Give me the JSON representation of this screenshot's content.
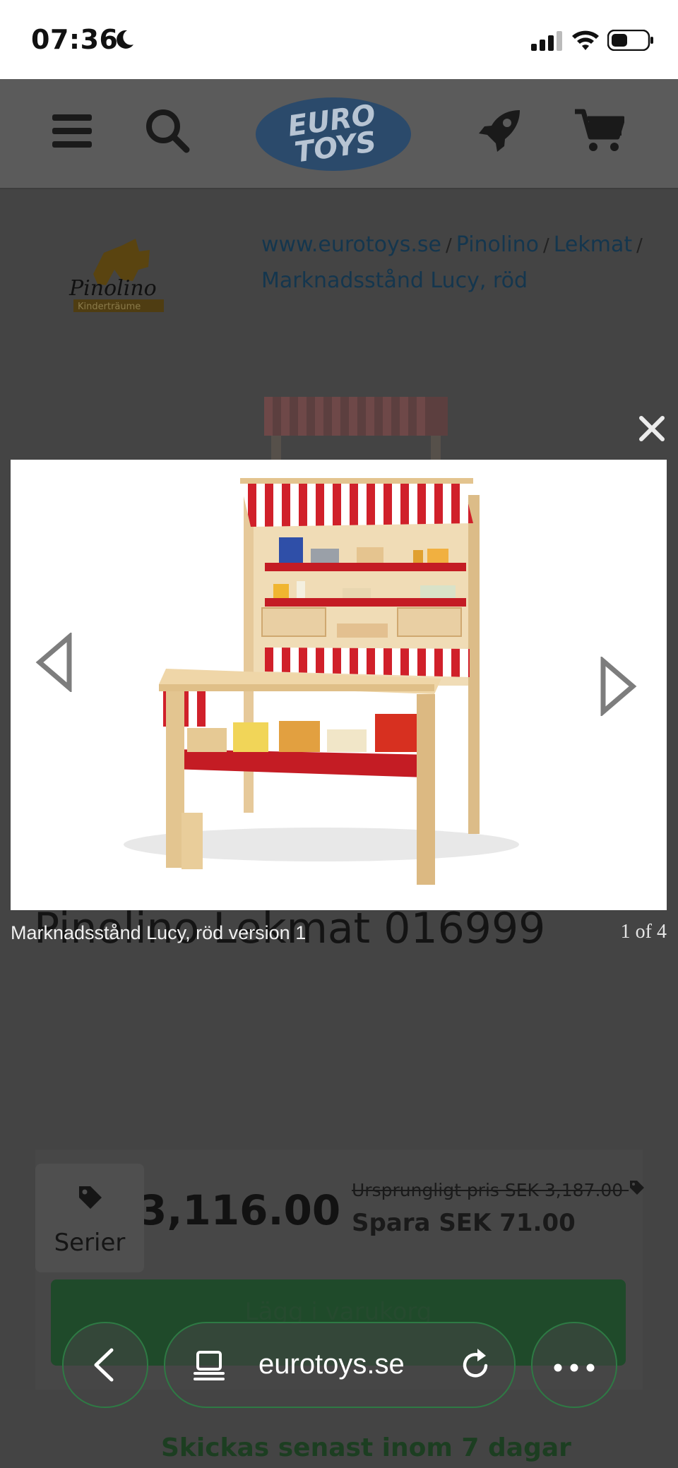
{
  "status_bar": {
    "time": "07:36"
  },
  "header": {
    "logo_text_line1": "EURO",
    "logo_text_line2": "TOYS"
  },
  "brand": {
    "name": "Pinolino",
    "tagline": "Kinderträume"
  },
  "breadcrumb": {
    "items": [
      "www.eurotoys.se",
      "Pinolino",
      "Lekmat",
      "Marknadsstånd Lucy, röd"
    ],
    "separator": "/"
  },
  "product": {
    "background_title": "Pinolino Lekmat 016999",
    "price": "3,116.00",
    "original_price": "Ursprungligt pris SEK 3,187.00",
    "savings": "Spara SEK 71.00",
    "buy_label": "Lägg i varukorg",
    "shipping": "Skickas senast inom 7 dagar"
  },
  "series_button": {
    "label": "Serier"
  },
  "lightbox": {
    "caption": "Marknadsstånd Lucy, röd version 1",
    "counter": "1 of 4"
  },
  "browser": {
    "url": "eurotoys.se"
  },
  "colors": {
    "link": "#14364e",
    "accent_green": "#2e7a44",
    "stripe_red": "#d0202a"
  }
}
